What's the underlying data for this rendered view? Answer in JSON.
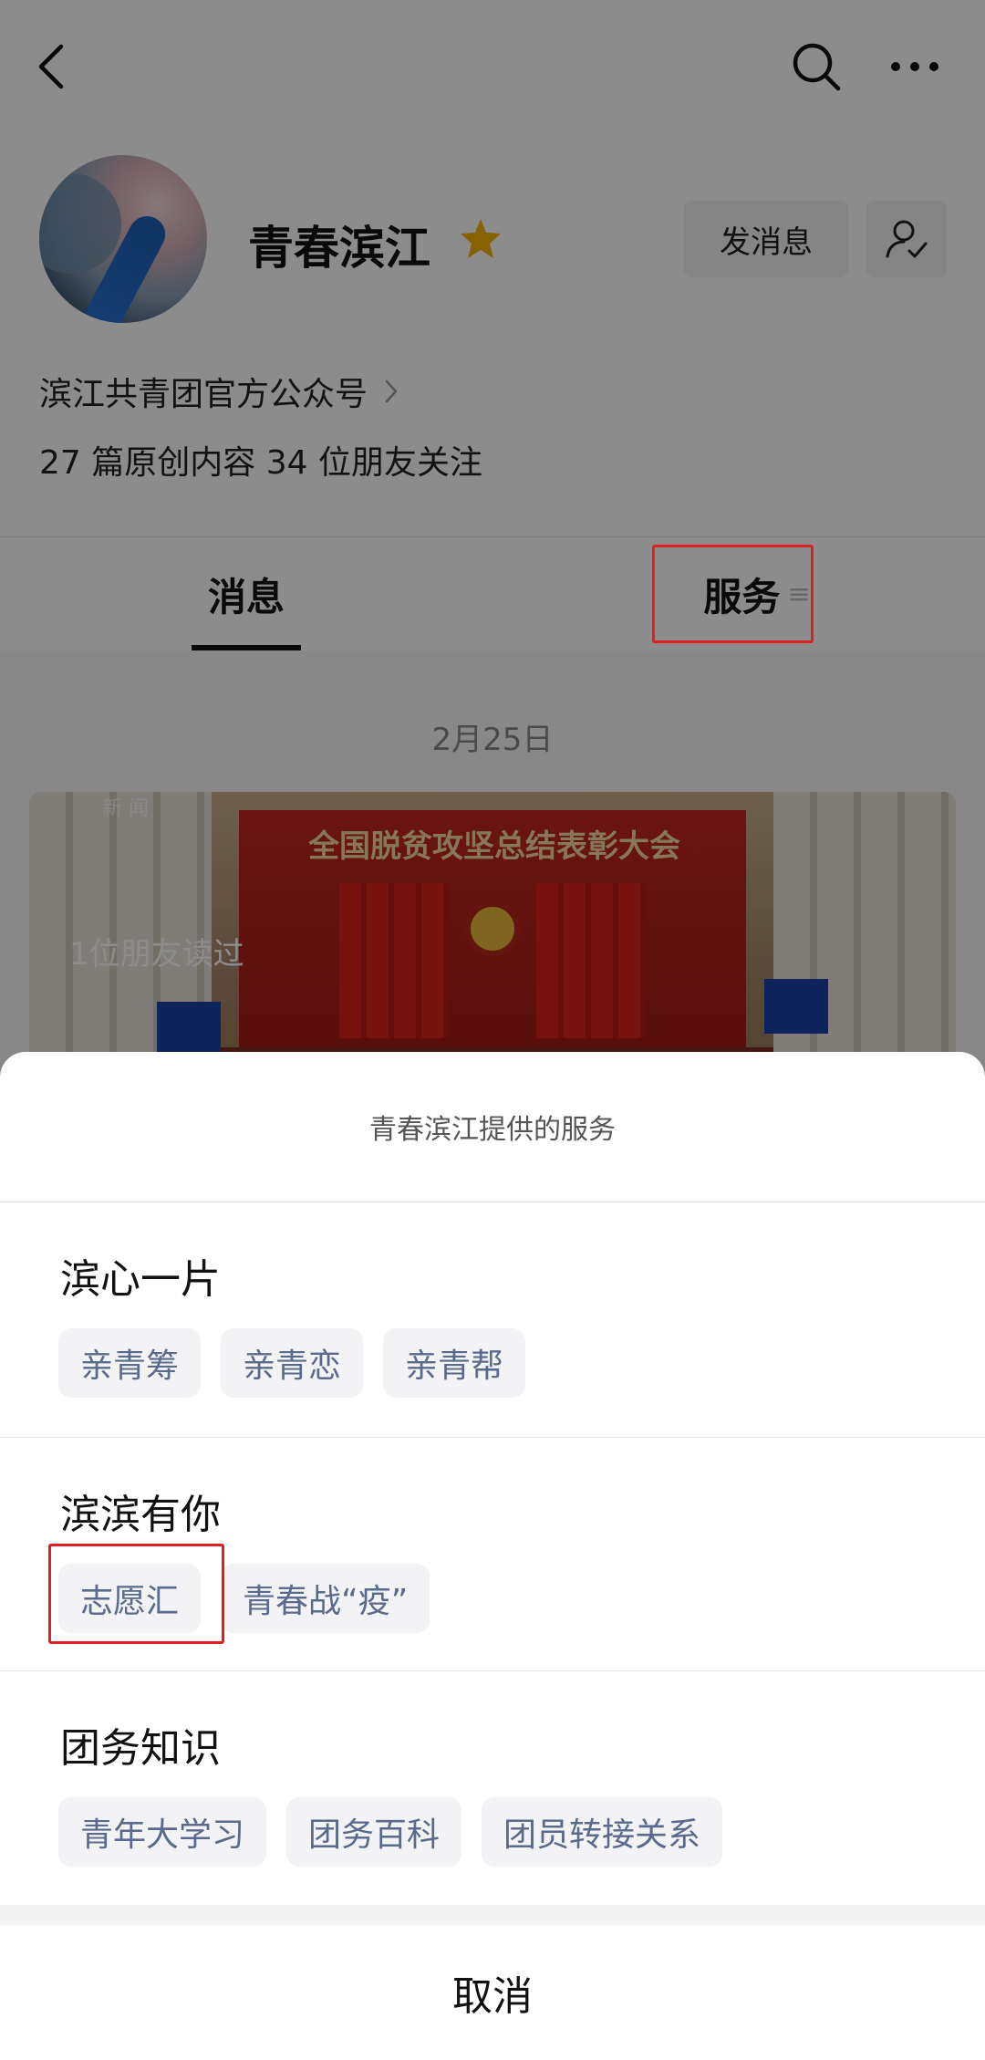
{
  "account": {
    "name": "青春滨江",
    "description": "滨江共青团官方公众号",
    "stats": "27 篇原创内容  34 位朋友关注",
    "message_button": "发消息"
  },
  "icons": {
    "back": "chevron-left-icon",
    "search": "search-icon",
    "more": "more-dots-icon",
    "star": "star-icon",
    "follow": "user-check-icon"
  },
  "tabs": {
    "messages": "消息",
    "services": "服务",
    "services_menu_glyph": "≡"
  },
  "feed": {
    "date": "2月25日",
    "article_banner": "全国脱贫攻坚总结表彰大会",
    "news_tag": "新 闻",
    "read_count": "1位朋友读过"
  },
  "sheet": {
    "title": "青春滨江提供的服务",
    "sections": [
      {
        "title": "滨心一片",
        "items": [
          "亲青筹",
          "亲青恋",
          "亲青帮"
        ]
      },
      {
        "title": "滨滨有你",
        "items": [
          "志愿汇",
          "青春战“疫”"
        ]
      },
      {
        "title": "团务知识",
        "items": [
          "青年大学习",
          "团务百科",
          "团员转接关系"
        ]
      }
    ],
    "cancel": "取消"
  },
  "colors": {
    "star": "#f5b400",
    "chip_text": "#5a6a8c",
    "highlight": "#e02020"
  }
}
